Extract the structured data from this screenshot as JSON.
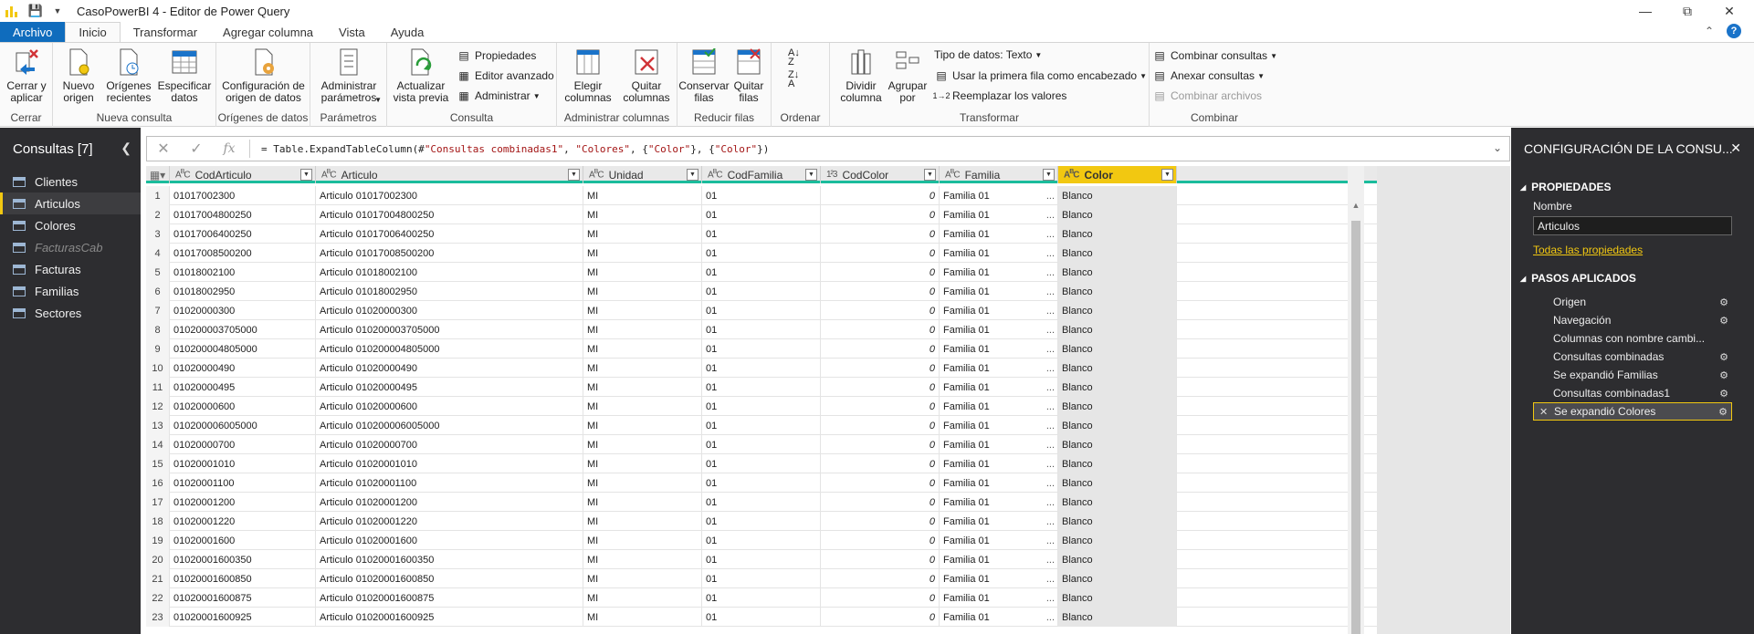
{
  "window": {
    "title": "CasoPowerBI 4 - Editor de Power Query"
  },
  "menu_tabs": [
    "Archivo",
    "Inicio",
    "Transformar",
    "Agregar columna",
    "Vista",
    "Ayuda"
  ],
  "ribbon": {
    "cerrar": {
      "btn": "Cerrar y aplicar",
      "group": "Cerrar"
    },
    "nueva_consulta": {
      "nuevo_origen": "Nuevo origen",
      "origenes_recientes": "Orígenes recientes",
      "especificar_datos": "Especificar datos",
      "group": "Nueva consulta"
    },
    "origenes": {
      "config": "Configuración de origen de datos",
      "group": "Orígenes de datos"
    },
    "parametros": {
      "administrar": "Administrar parámetros",
      "group": "Parámetros"
    },
    "consulta": {
      "actualizar": "Actualizar vista previa",
      "propiedades": "Propiedades",
      "editor": "Editor avanzado",
      "administrar": "Administrar",
      "group": "Consulta"
    },
    "columnas": {
      "elegir": "Elegir columnas",
      "quitar": "Quitar columnas",
      "group": "Administrar columnas"
    },
    "filas": {
      "conservar": "Conservar filas",
      "quitar": "Quitar filas",
      "group": "Reducir filas"
    },
    "ordenar": {
      "group": "Ordenar"
    },
    "transformar": {
      "dividir": "Dividir columna",
      "agrupar": "Agrupar por",
      "tipo": "Tipo de datos: Texto",
      "primera_fila": "Usar la primera fila como encabezado",
      "reemplazar": "Reemplazar los valores",
      "group": "Transformar"
    },
    "combinar": {
      "combinar_consultas": "Combinar consultas",
      "anexar": "Anexar consultas",
      "combinar_archivos": "Combinar archivos",
      "group": "Combinar"
    }
  },
  "queries_pane": {
    "title": "Consultas [7]",
    "items": [
      {
        "label": "Clientes",
        "state": "normal"
      },
      {
        "label": "Articulos",
        "state": "selected"
      },
      {
        "label": "Colores",
        "state": "normal"
      },
      {
        "label": "FacturasCab",
        "state": "disabled"
      },
      {
        "label": "Facturas",
        "state": "normal"
      },
      {
        "label": "Familias",
        "state": "normal"
      },
      {
        "label": "Sectores",
        "state": "normal"
      }
    ]
  },
  "formula": {
    "prefix": "= Table.ExpandTableColumn(#",
    "s1": "\"Consultas combinadas1\"",
    "m1": ", ",
    "s2": "\"Colores\"",
    "m2": ", {",
    "s3": "\"Color\"",
    "m3": "}, {",
    "s4": "\"Color\"",
    "suffix": "})"
  },
  "grid": {
    "columns": [
      {
        "type": "ABC",
        "name": "CodArticulo"
      },
      {
        "type": "ABC",
        "name": "Articulo"
      },
      {
        "type": "ABC",
        "name": "Unidad"
      },
      {
        "type": "ABC",
        "name": "CodFamilia"
      },
      {
        "type": "123",
        "name": "CodColor"
      },
      {
        "type": "ABC",
        "name": "Familia"
      },
      {
        "type": "ABC",
        "name": "Color"
      }
    ],
    "rows": [
      [
        "1",
        "01017002300",
        "Articulo 01017002300",
        "MI",
        "01",
        "0",
        "Familia 01",
        "Blanco"
      ],
      [
        "2",
        "01017004800250",
        "Articulo 01017004800250",
        "MI",
        "01",
        "0",
        "Familia 01",
        "Blanco"
      ],
      [
        "3",
        "01017006400250",
        "Articulo 01017006400250",
        "MI",
        "01",
        "0",
        "Familia 01",
        "Blanco"
      ],
      [
        "4",
        "01017008500200",
        "Articulo 01017008500200",
        "MI",
        "01",
        "0",
        "Familia 01",
        "Blanco"
      ],
      [
        "5",
        "01018002100",
        "Articulo 01018002100",
        "MI",
        "01",
        "0",
        "Familia 01",
        "Blanco"
      ],
      [
        "6",
        "01018002950",
        "Articulo 01018002950",
        "MI",
        "01",
        "0",
        "Familia 01",
        "Blanco"
      ],
      [
        "7",
        "01020000300",
        "Articulo 01020000300",
        "MI",
        "01",
        "0",
        "Familia 01",
        "Blanco"
      ],
      [
        "8",
        "010200003705000",
        "Articulo 010200003705000",
        "MI",
        "01",
        "0",
        "Familia 01",
        "Blanco"
      ],
      [
        "9",
        "010200004805000",
        "Articulo 010200004805000",
        "MI",
        "01",
        "0",
        "Familia 01",
        "Blanco"
      ],
      [
        "10",
        "01020000490",
        "Articulo 01020000490",
        "MI",
        "01",
        "0",
        "Familia 01",
        "Blanco"
      ],
      [
        "11",
        "01020000495",
        "Articulo 01020000495",
        "MI",
        "01",
        "0",
        "Familia 01",
        "Blanco"
      ],
      [
        "12",
        "01020000600",
        "Articulo 01020000600",
        "MI",
        "01",
        "0",
        "Familia 01",
        "Blanco"
      ],
      [
        "13",
        "010200006005000",
        "Articulo 010200006005000",
        "MI",
        "01",
        "0",
        "Familia 01",
        "Blanco"
      ],
      [
        "14",
        "01020000700",
        "Articulo 01020000700",
        "MI",
        "01",
        "0",
        "Familia 01",
        "Blanco"
      ],
      [
        "15",
        "01020001010",
        "Articulo 01020001010",
        "MI",
        "01",
        "0",
        "Familia 01",
        "Blanco"
      ],
      [
        "16",
        "01020001100",
        "Articulo 01020001100",
        "MI",
        "01",
        "0",
        "Familia 01",
        "Blanco"
      ],
      [
        "17",
        "01020001200",
        "Articulo 01020001200",
        "MI",
        "01",
        "0",
        "Familia 01",
        "Blanco"
      ],
      [
        "18",
        "01020001220",
        "Articulo 01020001220",
        "MI",
        "01",
        "0",
        "Familia 01",
        "Blanco"
      ],
      [
        "19",
        "01020001600",
        "Articulo 01020001600",
        "MI",
        "01",
        "0",
        "Familia 01",
        "Blanco"
      ],
      [
        "20",
        "01020001600350",
        "Articulo 01020001600350",
        "MI",
        "01",
        "0",
        "Familia 01",
        "Blanco"
      ],
      [
        "21",
        "01020001600850",
        "Articulo 01020001600850",
        "MI",
        "01",
        "0",
        "Familia 01",
        "Blanco"
      ],
      [
        "22",
        "01020001600875",
        "Articulo 01020001600875",
        "MI",
        "01",
        "0",
        "Familia 01",
        "Blanco"
      ],
      [
        "23",
        "01020001600925",
        "Articulo 01020001600925",
        "MI",
        "01",
        "0",
        "Familia 01",
        "Blanco"
      ]
    ]
  },
  "settings_pane": {
    "title": "CONFIGURACIÓN DE LA CONSU...",
    "properties_header": "PROPIEDADES",
    "name_label": "Nombre",
    "name_value": "Articulos",
    "all_props_link": "Todas las propiedades",
    "steps_header": "PASOS APLICADOS",
    "steps": [
      {
        "label": "Origen",
        "gear": true
      },
      {
        "label": "Navegación",
        "gear": true
      },
      {
        "label": "Columnas con nombre cambi...",
        "gear": false
      },
      {
        "label": "Consultas combinadas",
        "gear": true
      },
      {
        "label": "Se expandió Familias",
        "gear": true
      },
      {
        "label": "Consultas combinadas1",
        "gear": true
      },
      {
        "label": "Se expandió Colores",
        "gear": true,
        "active": true
      }
    ]
  },
  "colors": {
    "accent_yellow": "#f2c811",
    "file_tab_blue": "#0f6cbd",
    "dark_pane": "#2d2d30",
    "header_underline": "#1abc9c"
  }
}
